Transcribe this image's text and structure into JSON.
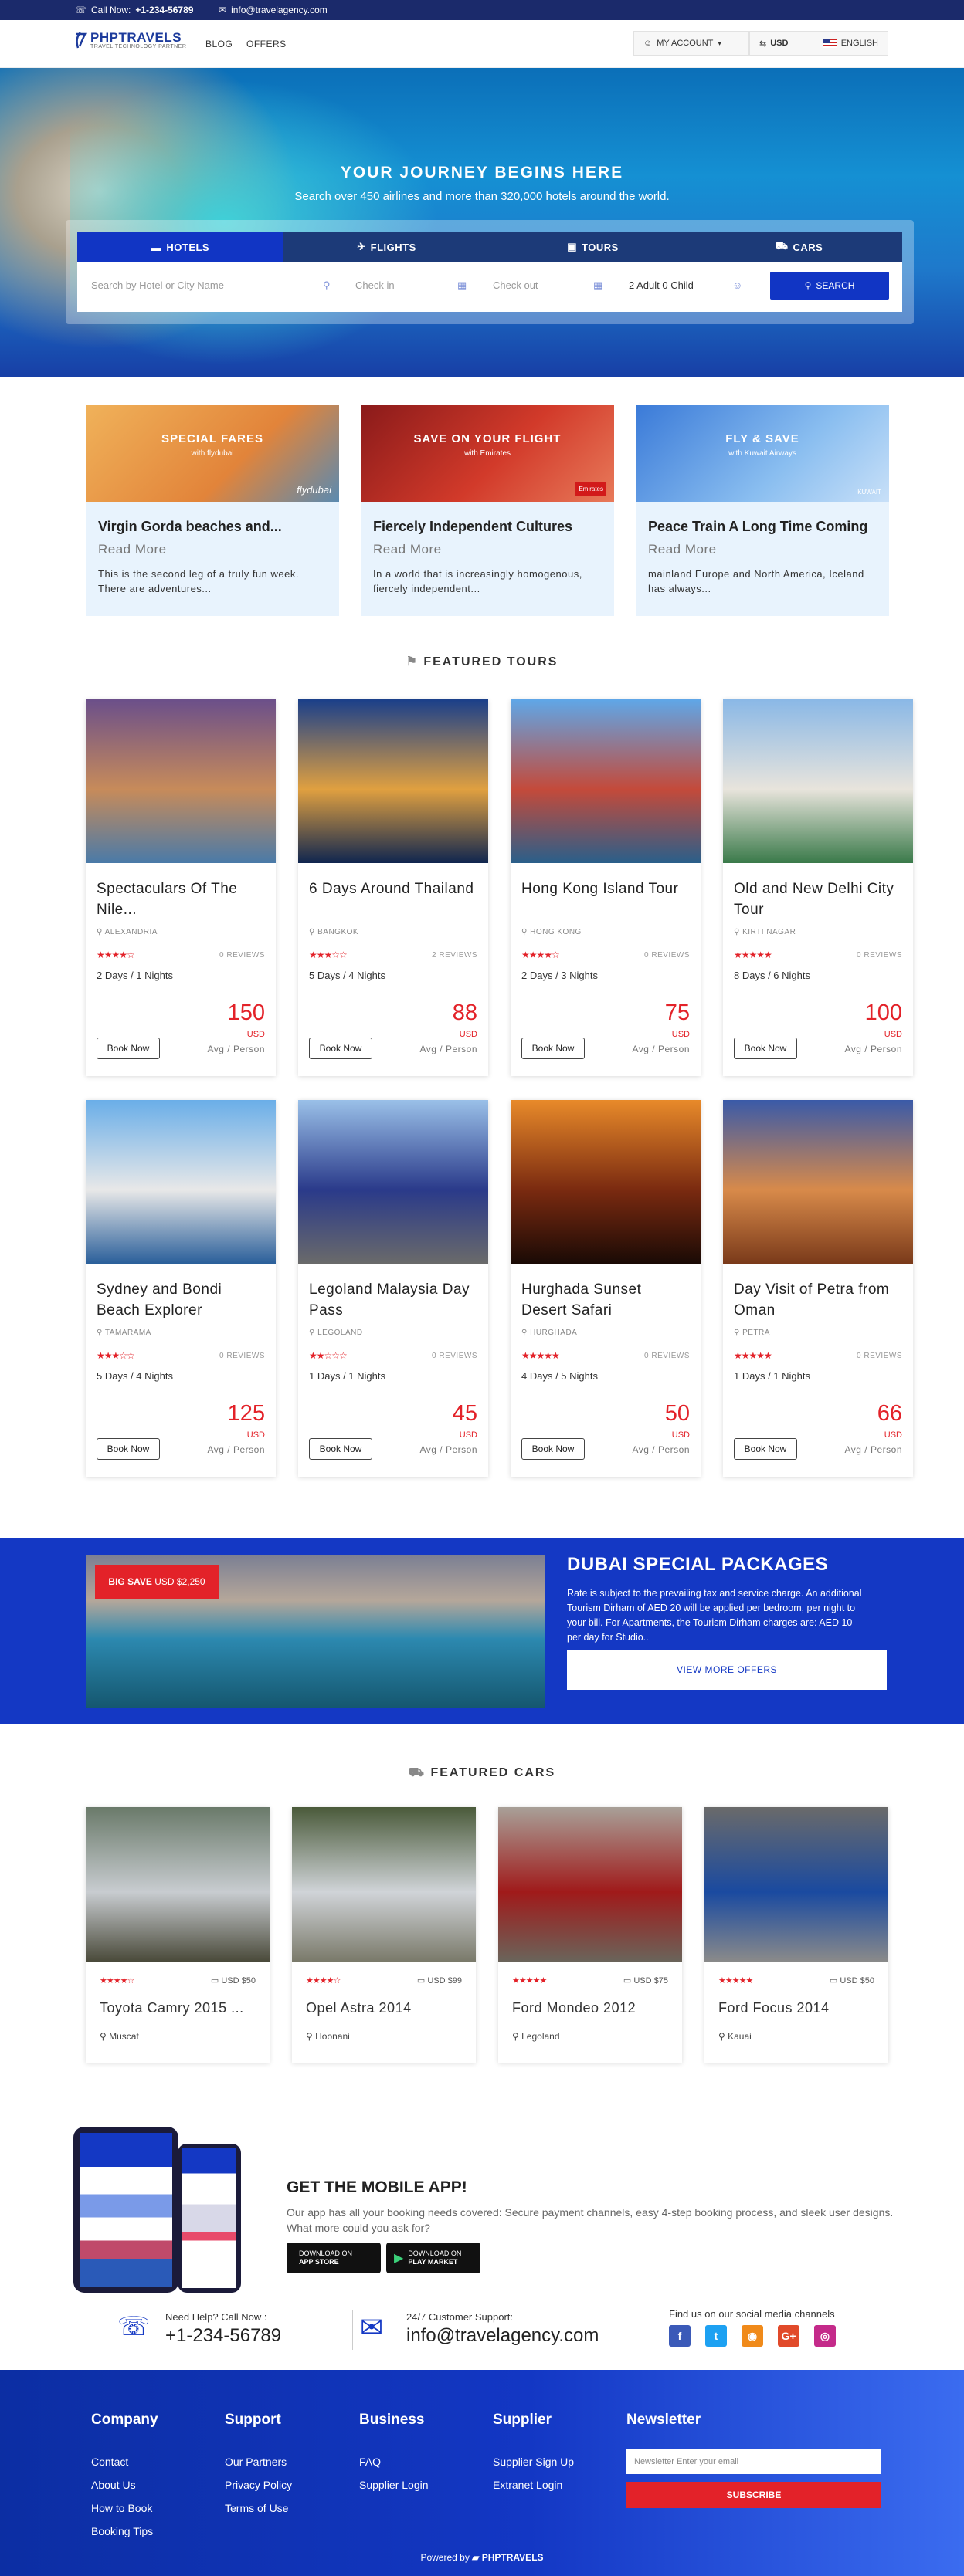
{
  "topbar": {
    "call_label": "Call Now:",
    "phone": "+1-234-56789",
    "email": "info@travelagency.com"
  },
  "nav": {
    "brand": "PHPTRAVELS",
    "tagline": "TRAVEL TECHNOLOGY PARTNER",
    "links": [
      "BLOG",
      "OFFERS"
    ],
    "account": "MY ACCOUNT",
    "currency": "USD",
    "language": "ENGLISH"
  },
  "hero": {
    "title": "YOUR JOURNEY BEGINS HERE",
    "subtitle": "Search over 450 airlines and more than 320,000 hotels around the world.",
    "tabs": [
      "HOTELS",
      "FLIGHTS",
      "TOURS",
      "CARS"
    ],
    "active_tab": "HOTELS",
    "search_placeholder": "Search by Hotel or City Name",
    "checkin": "Check in",
    "checkout": "Check out",
    "guests": "2 Adult 0 Child",
    "search_button": "SEARCH"
  },
  "offers": [
    {
      "badge_title": "SPECIAL FARES",
      "badge_sub": "with flydubai",
      "brand": "flydubai",
      "title": "Virgin Gorda beaches and...",
      "read_more": "Read More",
      "desc": "This is the second leg of a truly fun week. There are adventures..."
    },
    {
      "badge_title": "SAVE ON YOUR FLIGHT",
      "badge_sub": "with Emirates",
      "brand": "Emirates",
      "title": "Fiercely Independent Cultures",
      "read_more": "Read More",
      "desc": "In a world that is increasingly homogenous, fiercely independent..."
    },
    {
      "badge_title": "FLY & SAVE",
      "badge_sub": "with Kuwait Airways",
      "brand": "KUWAIT",
      "title": "Peace Train A Long Time Coming",
      "read_more": "Read More",
      "desc": "mainland Europe and North America, Iceland has always..."
    }
  ],
  "featured_tours_title": "FEATURED TOURS",
  "tours": [
    {
      "title": "Spectaculars Of The Nile...",
      "location": "ALEXANDRIA",
      "rating": 4,
      "reviews": "0 REVIEWS",
      "duration": "2 Days / 1 Nights",
      "price": "150",
      "currency": "USD",
      "per": "Avg / Person",
      "book": "Book Now",
      "colors": [
        "#6b4f8a",
        "#c78b5a",
        "#4a7aa8"
      ]
    },
    {
      "title": "6 Days Around Thailand",
      "location": "BANGKOK",
      "rating": 3,
      "reviews": "2 REVIEWS",
      "duration": "5 Days / 4 Nights",
      "price": "88",
      "currency": "USD",
      "per": "Avg / Person",
      "book": "Book Now",
      "colors": [
        "#1a3f8a",
        "#e0a040",
        "#10264f"
      ]
    },
    {
      "title": "Hong Kong Island Tour",
      "location": "HONG KONG",
      "rating": 4,
      "reviews": "0 REVIEWS",
      "duration": "2 Days / 3 Nights",
      "price": "75",
      "currency": "USD",
      "per": "Avg / Person",
      "book": "Book Now",
      "colors": [
        "#5fa7e8",
        "#c44a3a",
        "#2a5f8a"
      ]
    },
    {
      "title": "Old and New Delhi City Tour",
      "location": "KIRTI NAGAR",
      "rating": 5,
      "reviews": "0 REVIEWS",
      "duration": "8 Days / 6 Nights",
      "price": "100",
      "currency": "USD",
      "per": "Avg / Person",
      "book": "Book Now",
      "colors": [
        "#8ab8e6",
        "#e8e4dc",
        "#3a7a4a"
      ]
    },
    {
      "title": "Sydney and Bondi Beach Explorer",
      "location": "TAMARAMA",
      "rating": 3,
      "reviews": "0 REVIEWS",
      "duration": "5 Days / 4 Nights",
      "price": "125",
      "currency": "USD",
      "per": "Avg / Person",
      "book": "Book Now",
      "colors": [
        "#6aaee8",
        "#e8e8e8",
        "#2a5f9a"
      ]
    },
    {
      "title": "Legoland Malaysia Day Pass",
      "location": "LEGOLAND",
      "rating": 2,
      "reviews": "0 REVIEWS",
      "duration": "1 Days / 1 Nights",
      "price": "45",
      "currency": "USD",
      "per": "Avg / Person",
      "book": "Book Now",
      "colors": [
        "#9ac0e8",
        "#2a3a8a",
        "#6a6a6a"
      ]
    },
    {
      "title": "Hurghada Sunset Desert Safari",
      "location": "HURGHADA",
      "rating": 5,
      "reviews": "0 REVIEWS",
      "duration": "4 Days / 5 Nights",
      "price": "50",
      "currency": "USD",
      "per": "Avg / Person",
      "book": "Book Now",
      "colors": [
        "#e88a2a",
        "#7a2a10",
        "#1a0a05"
      ]
    },
    {
      "title": "Day Visit of Petra from Oman",
      "location": "PETRA",
      "rating": 5,
      "reviews": "0 REVIEWS",
      "duration": "1 Days / 1 Nights",
      "price": "66",
      "currency": "USD",
      "per": "Avg / Person",
      "book": "Book Now",
      "colors": [
        "#3a5aa8",
        "#d88a4a",
        "#7a3a1a"
      ]
    }
  ],
  "dubai": {
    "deal_bold": "BIG SAVE",
    "deal_price": "USD $2,250",
    "title": "DUBAI SPECIAL PACKAGES",
    "text": "Rate is subject to the prevailing tax and service charge. An additional Tourism Dirham of AED 20 will be applied per bedroom, per night to your bill. For Apartments, the Tourism Dirham charges are: AED 10 per day for Studio..",
    "button": "VIEW MORE OFFERS"
  },
  "featured_cars_title": "FEATURED CARS",
  "cars": [
    {
      "name": "Toyota Camry 2015 ...",
      "price": "USD $50",
      "rating": 4,
      "location": "Muscat",
      "colors": [
        "#6a7a6a",
        "#c8ccd0",
        "#4a4a3a"
      ]
    },
    {
      "name": "Opel Astra 2014",
      "price": "USD $99",
      "rating": 4,
      "location": "Hoonani",
      "colors": [
        "#4a5a3a",
        "#d0d4d8",
        "#7a7a6a"
      ]
    },
    {
      "name": "Ford Mondeo 2012",
      "price": "USD $75",
      "rating": 5,
      "location": "Legoland",
      "colors": [
        "#a8a098",
        "#a01a1a",
        "#6a645a"
      ]
    },
    {
      "name": "Ford Focus 2014",
      "price": "USD $50",
      "rating": 5,
      "location": "Kauai",
      "colors": [
        "#6a6a6a",
        "#1a4aa0",
        "#8a8a8a"
      ]
    }
  ],
  "app": {
    "title": "GET THE MOBILE APP!",
    "text": "Our app has all your booking needs covered: Secure payment channels, easy 4-step booking process, and sleek user designs. What more could you ask for?",
    "appstore_top": "DOWNLOAD ON",
    "appstore": "APP STORE",
    "play_top": "DOWNLOAD ON",
    "play": "PLAY MARKET"
  },
  "contact": {
    "help_label": "Need Help? Call Now :",
    "phone": "+1-234-56789",
    "support_label": "24/7 Customer Support:",
    "email": "info@travelagency.com",
    "social_label": "Find us on our social media channels"
  },
  "footer": {
    "columns": [
      {
        "title": "Company",
        "links": [
          "Contact",
          "About Us",
          "How to Book",
          "Booking Tips"
        ]
      },
      {
        "title": "Support",
        "links": [
          "Our Partners",
          "Privacy Policy",
          "Terms of Use"
        ]
      },
      {
        "title": "Business",
        "links": [
          "FAQ",
          "Supplier Login"
        ]
      },
      {
        "title": "Supplier",
        "links": [
          "Supplier Sign Up",
          "Extranet Login"
        ]
      }
    ],
    "newsletter_title": "Newsletter",
    "newsletter_placeholder": "Newsletter Enter your email",
    "subscribe": "SUBSCRIBE",
    "powered_by": "Powered by",
    "powered_brand": "PHPTRAVELS"
  }
}
